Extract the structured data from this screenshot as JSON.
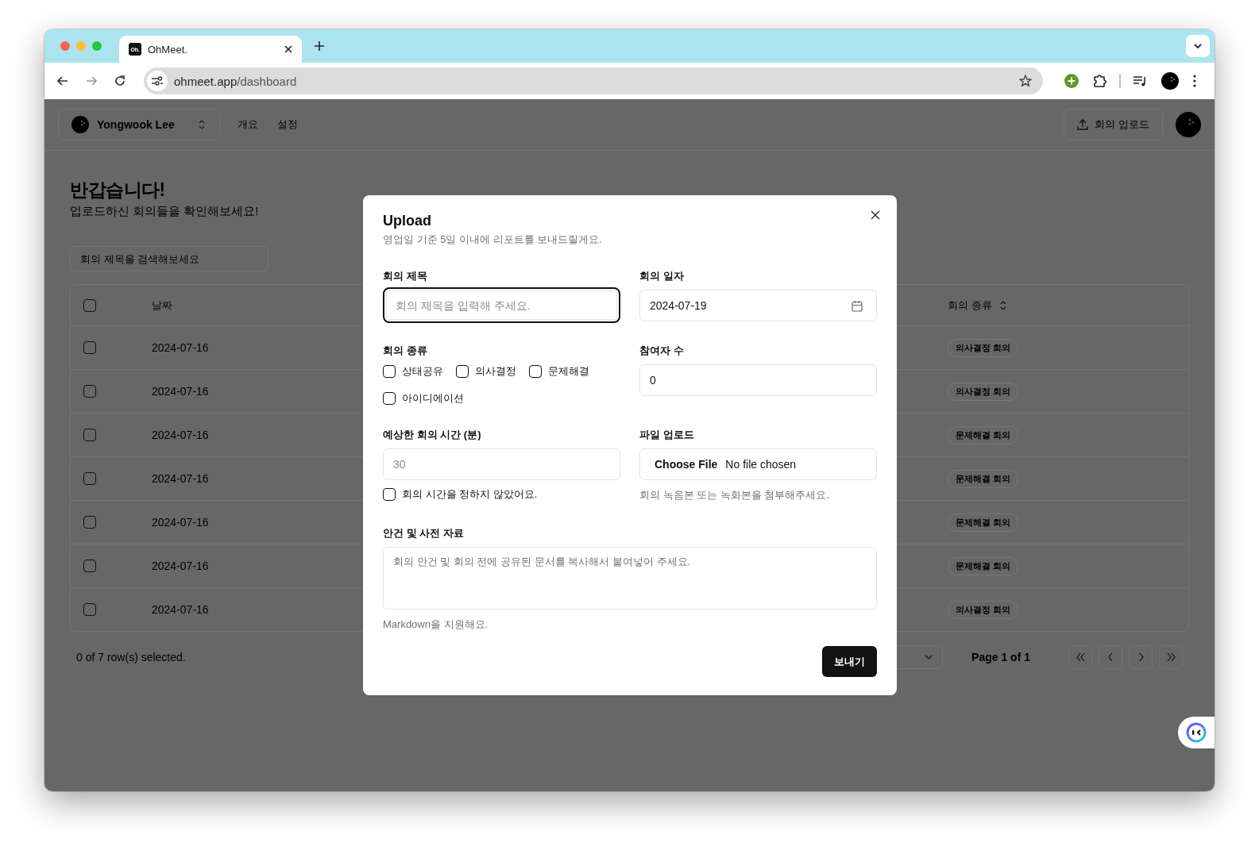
{
  "browser": {
    "tabs": [
      {
        "favicon_text": "Oh.",
        "title": "OhMeet.",
        "selected": true
      }
    ],
    "url_host": "ohmeet.app",
    "url_path": "/dashboard"
  },
  "header": {
    "workspace": "Yongwook Lee",
    "nav": [
      {
        "label": "개요"
      },
      {
        "label": "설정"
      }
    ],
    "upload_button": "회의 업로드"
  },
  "dashboard": {
    "title": "반갑습니다!",
    "subtitle": "업로드하신 회의들을 확인해보세요!",
    "search": {
      "placeholder": "회의 제목을 검색해보세요"
    },
    "table": {
      "columns": [
        {
          "label": "날짜",
          "sortable": false
        },
        {
          "label": "회의 종류",
          "sortable": true
        }
      ],
      "header_checked": false,
      "rows": [
        {
          "checked": false,
          "date": "2024-07-16",
          "type": "의사결정 회의"
        },
        {
          "checked": false,
          "date": "2024-07-16",
          "type": "의사결정 회의"
        },
        {
          "checked": false,
          "date": "2024-07-16",
          "type": "문제해결 회의"
        },
        {
          "checked": false,
          "date": "2024-07-16",
          "type": "문제해결 회의"
        },
        {
          "checked": false,
          "date": "2024-07-16",
          "type": "문제해결 회의"
        },
        {
          "checked": false,
          "date": "2024-07-16",
          "type": "문제해결 회의"
        },
        {
          "checked": false,
          "date": "2024-07-16",
          "type": "의사결정 회의"
        }
      ]
    },
    "selection_status": "0 of 7 row(s) selected.",
    "page_label": "Page 1 of 1"
  },
  "dialog": {
    "title": "Upload",
    "description": "영업일 기준 5일 이내에 리포트를 보내드릴게요.",
    "meeting_title": {
      "label": "회의 제목",
      "placeholder": "회의 제목을 입력해 주세요.",
      "focused": true
    },
    "meeting_date": {
      "label": "회의 일자",
      "value": "2024-07-19"
    },
    "meeting_type": {
      "label": "회의 종류",
      "options": [
        {
          "label": "상태공유",
          "checked": false
        },
        {
          "label": "의사결정",
          "checked": false
        },
        {
          "label": "문제해결",
          "checked": false
        },
        {
          "label": "아이디에이션",
          "checked": false
        }
      ]
    },
    "participants": {
      "label": "참여자 수",
      "value": "0"
    },
    "duration": {
      "label": "예상한 회의 시간 (분)",
      "placeholder": "30",
      "unset_option": {
        "label": "회의 시간을 정하지 않았어요.",
        "checked": false
      }
    },
    "file": {
      "label": "파일 업로드",
      "button": "Choose File",
      "status": "No file chosen",
      "hint": "회의 녹음본 또는 녹화본을 첨부해주세요."
    },
    "agenda": {
      "label": "안건 및 사전 자료",
      "placeholder": "회의 안건 및 회의 전에 공유된 문서를 복사해서 붙여넣어 주세요.",
      "hint": "Markdown을 지원해요."
    },
    "submit": "보내기"
  }
}
